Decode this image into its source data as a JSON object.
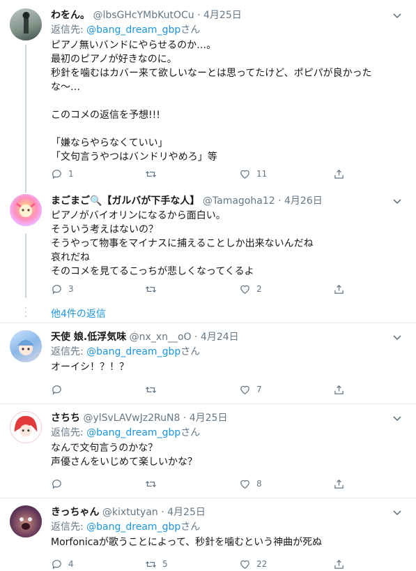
{
  "tweets": [
    {
      "name": "わをん。",
      "handle": "@lbsGHcYMbKutOCu",
      "date": "4月25日",
      "reply_prefix": "返信先: ",
      "reply_handle": "@bang_dream_gbp",
      "reply_suffix": "さん",
      "text": "ピアノ無いバンドにやらせるのか…。\n最初のピアノが好きなのに。\n秒針を噛むはカバー来て欲しいなーとは思ってたけど、ポピパが良かった\nな〜…\n\nこのコメの返信を予想!!!\n\n「嫌ならやらなくていい」\n「文句言うやつはバンドリやめろ」等",
      "reply_count": "1",
      "retweet_count": "",
      "like_count": "11"
    },
    {
      "name": "まごまご🔍【ガルバが下手な人】",
      "handle": "@Tamagoha12",
      "date": "4月26日",
      "text": "ピアノがバイオリンになるから面白い。\nそういう考えはないの？\nそうやって物事をマイナスに捕えることしか出来ないんだね\n哀れだね\nそのコメを見てるこっちが悲しくなってくるよ",
      "reply_count": "3",
      "retweet_count": "",
      "like_count": "2"
    },
    {
      "name": "天使 娘.低浮気味",
      "handle": "@nx_xn__oO",
      "date": "4月24日",
      "reply_prefix": "返信先: ",
      "reply_handle": "@bang_dream_gbp",
      "reply_suffix": "さん",
      "text": "オーイシ！？！？",
      "reply_count": "",
      "retweet_count": "",
      "like_count": "7"
    },
    {
      "name": "さちち",
      "handle": "@ylSvLAVwJz2RuN8",
      "date": "4月25日",
      "reply_prefix": "返信先: ",
      "reply_handle": "@bang_dream_gbp",
      "reply_suffix": "さん",
      "text": "なんで文句言うのかな？\n声優さんをいじめて楽しいかな？",
      "reply_count": "",
      "retweet_count": "",
      "like_count": "8"
    },
    {
      "name": "きっちゃん",
      "handle": "@kixtutyan",
      "date": "4月25日",
      "reply_prefix": "返信先: ",
      "reply_handle": "@bang_dream_gbp",
      "reply_suffix": "さん",
      "text": "Morfonicaが歌うことによって、秒針を噛むという神曲が死ぬ",
      "reply_count": "4",
      "retweet_count": "5",
      "like_count": "22"
    }
  ],
  "more_replies": "他4件の返信",
  "colors": {
    "link": "#1b95e0",
    "muted": "#657786",
    "border": "#e6ecf0"
  }
}
